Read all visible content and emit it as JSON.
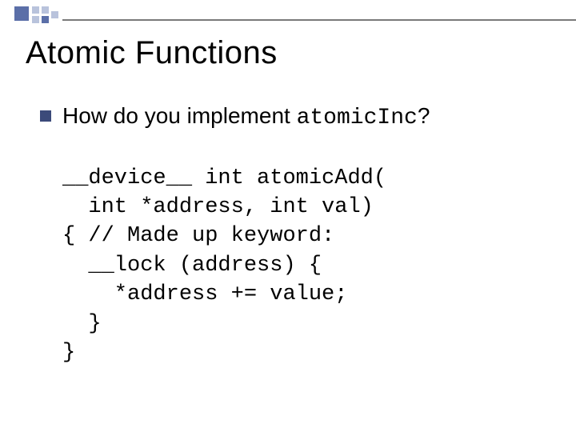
{
  "title": "Atomic Functions",
  "bullet": {
    "prefix": "How do you implement ",
    "code": "atomicInc",
    "suffix": "?"
  },
  "code": {
    "l1": "__device__ int atomicAdd(",
    "l2": "  int *address, int val)",
    "l3": "{ // Made up keyword:",
    "l4": "  __lock (address) {",
    "l5": "    *address += value;",
    "l6": "  }",
    "l7": "}"
  }
}
